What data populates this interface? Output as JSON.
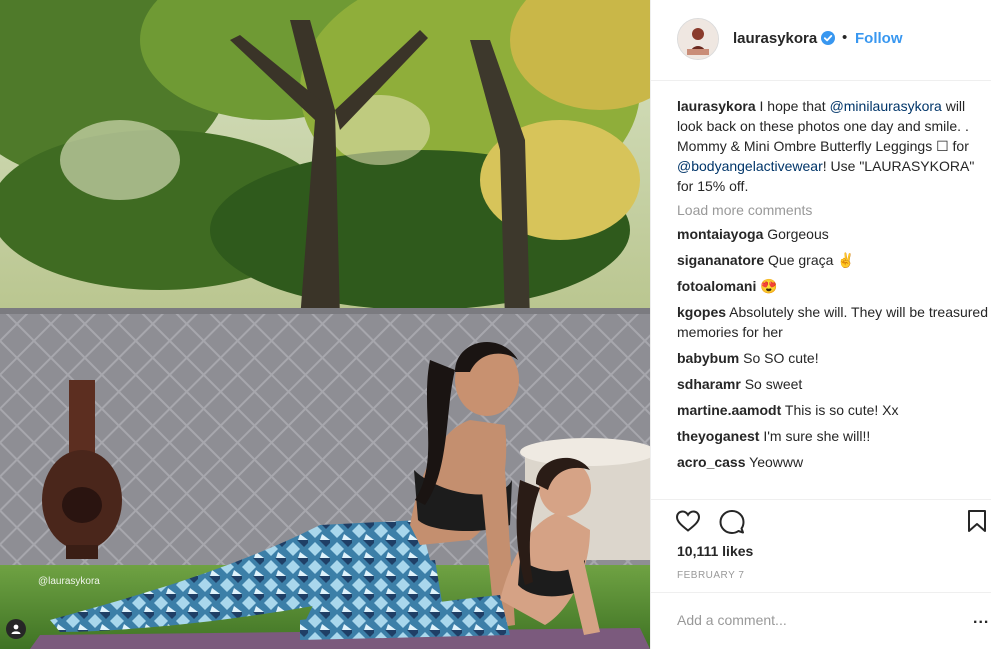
{
  "photo": {
    "watermark": "@laurasykora"
  },
  "header": {
    "username": "laurasykora",
    "separator": "•",
    "follow_label": "Follow"
  },
  "caption": {
    "username": "laurasykora",
    "text_1": " I hope that ",
    "mention_1": "@minilaurasykora",
    "text_2": " will look back on these photos one day and smile. .",
    "text_3": "Mommy & Mini Ombre Butterfly Leggings ☐ for ",
    "mention_2": "@bodyangelactivewear",
    "text_4": "! Use \"LAURASYKORA\" for 15% off."
  },
  "load_more_label": "Load more comments",
  "comments": [
    {
      "user": "montaiayoga",
      "text": "Gorgeous"
    },
    {
      "user": "sigananatore",
      "text": "Que graça ✌"
    },
    {
      "user": "fotoalomani",
      "text": "😍"
    },
    {
      "user": "kgopes",
      "text": "Absolutely she will. They will be treasured memories for her"
    },
    {
      "user": "babybum",
      "text": "So SO cute!"
    },
    {
      "user": "sdharamr",
      "text": "So sweet"
    },
    {
      "user": "martine.aamodt",
      "text": "This is so cute! Xx"
    },
    {
      "user": "theyoganest",
      "text": "I'm sure she will!!"
    },
    {
      "user": "acro_cass",
      "text": "Yeowww"
    }
  ],
  "icons": {
    "like": "heart-icon",
    "comment": "comment-bubble-icon",
    "save": "bookmark-icon",
    "verified": "verified-badge-icon",
    "tag": "user-tag-icon"
  },
  "likes_label": "10,111 likes",
  "date_label": "FEBRUARY 7",
  "add_comment": {
    "placeholder": "Add a comment..."
  },
  "more_label": "...",
  "colors": {
    "link": "#3897f0",
    "verified": "#3897f0",
    "muted": "#999999"
  }
}
